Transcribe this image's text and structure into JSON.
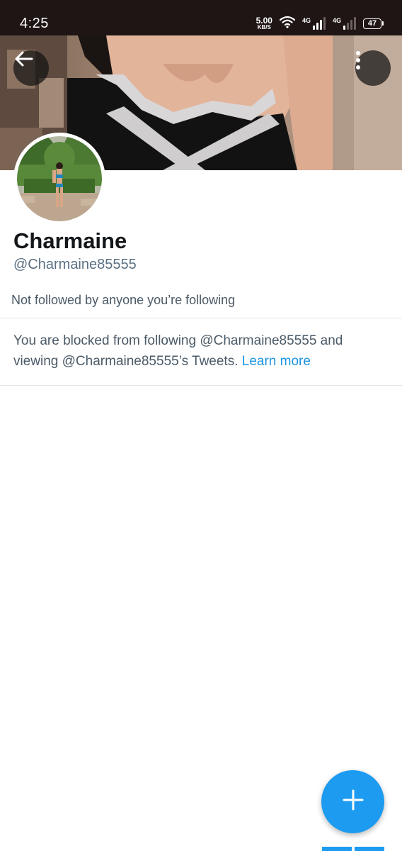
{
  "status_bar": {
    "time": "4:25",
    "net_speed_value": "5.00",
    "net_speed_unit": "KB/S",
    "sim1_label": "4G",
    "sim2_label": "4G",
    "battery": "47",
    "icons": [
      "wifi-icon",
      "signal-icon",
      "signal-icon",
      "battery-icon"
    ]
  },
  "header": {
    "back_icon": "arrow-left-icon",
    "more_icon": "more-vertical-icon"
  },
  "profile": {
    "display_name": "Charmaine",
    "handle": "@Charmaine85555",
    "followed_note": "Not followed by anyone you’re following"
  },
  "blocked_notice": {
    "message": "You are blocked from following @Charmaine85555 and viewing @Charmaine85555’s Tweets. ",
    "link_text": "Learn more"
  },
  "fab": {
    "icon": "plus-icon"
  },
  "colors": {
    "accent": "#1d9bf0",
    "link": "#1b95e0",
    "status_bar_bg": "#1e1514",
    "secondary_text": "#5b7083"
  }
}
